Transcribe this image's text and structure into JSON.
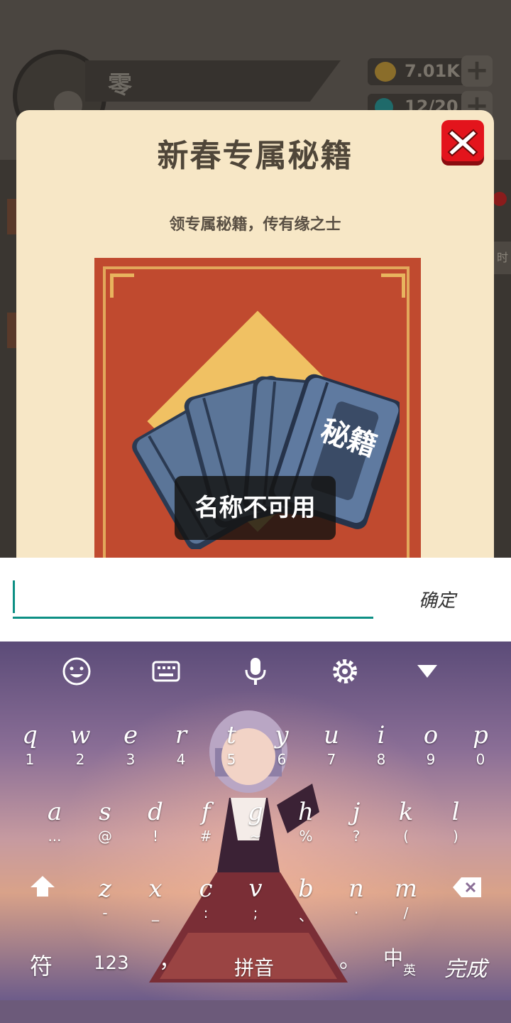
{
  "game": {
    "player_name": "零",
    "coins": "7.01K",
    "energy": "12/20"
  },
  "dialog": {
    "title": "新春专属秘籍",
    "subtitle": "领专属秘籍，传有缘之士",
    "card_text": "秘籍",
    "toast": "名称不可用"
  },
  "input": {
    "value": "",
    "placeholder": "",
    "confirm_label": "确定"
  },
  "keyboard": {
    "toolbar": [
      "emoji-icon",
      "keyboard-icon",
      "microphone-icon",
      "settings-icon",
      "collapse-icon"
    ],
    "row1": [
      {
        "main": "q",
        "sub": "1"
      },
      {
        "main": "w",
        "sub": "2"
      },
      {
        "main": "e",
        "sub": "3"
      },
      {
        "main": "r",
        "sub": "4"
      },
      {
        "main": "t",
        "sub": "5"
      },
      {
        "main": "y",
        "sub": "6"
      },
      {
        "main": "u",
        "sub": "7"
      },
      {
        "main": "i",
        "sub": "8"
      },
      {
        "main": "o",
        "sub": "9"
      },
      {
        "main": "p",
        "sub": "0"
      }
    ],
    "row2": [
      {
        "main": "a",
        "sub": "..."
      },
      {
        "main": "s",
        "sub": "@"
      },
      {
        "main": "d",
        "sub": "!"
      },
      {
        "main": "f",
        "sub": "#"
      },
      {
        "main": "g",
        "sub": "~"
      },
      {
        "main": "h",
        "sub": "%"
      },
      {
        "main": "j",
        "sub": "?"
      },
      {
        "main": "k",
        "sub": "("
      },
      {
        "main": "l",
        "sub": ")"
      }
    ],
    "row3": [
      {
        "main": "z",
        "sub": "-"
      },
      {
        "main": "x",
        "sub": "_"
      },
      {
        "main": "c",
        "sub": ":"
      },
      {
        "main": "v",
        "sub": ";"
      },
      {
        "main": "b",
        "sub": "、"
      },
      {
        "main": "n",
        "sub": "·"
      },
      {
        "main": "m",
        "sub": "/"
      }
    ],
    "bottom": {
      "symbols": "符",
      "numbers": "123",
      "comma": "，",
      "space": "拼音",
      "period": "。",
      "lang_main": "中",
      "lang_sub": "英",
      "done": "完成"
    }
  },
  "colors": {
    "dialog_bg": "#f7e7c6",
    "accent": "#0d8f84",
    "card_red": "#c04a2f",
    "close_red": "#e3141c"
  }
}
